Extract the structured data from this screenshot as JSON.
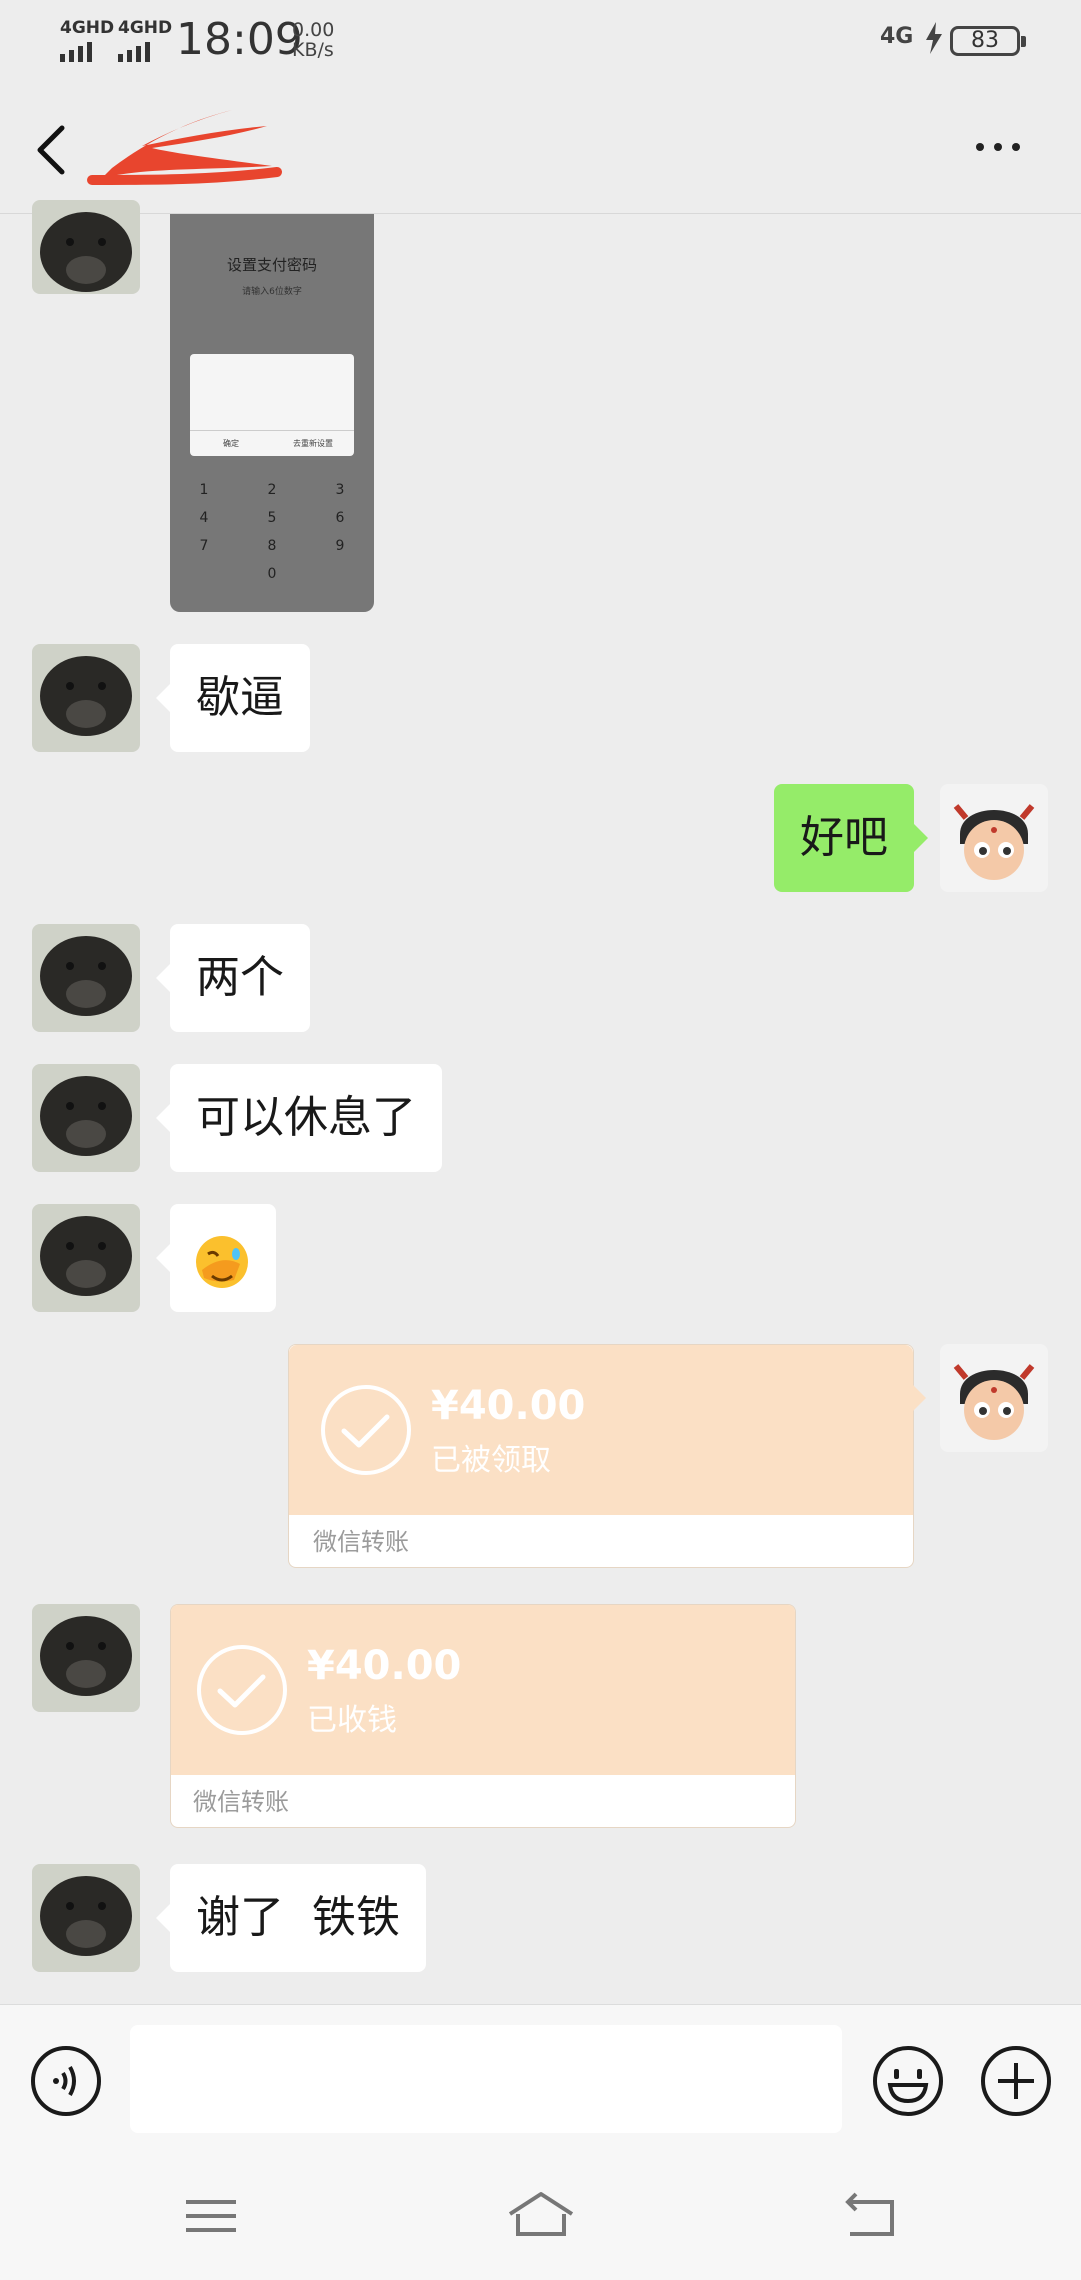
{
  "status_bar": {
    "signal1_label": "4GHD",
    "signal2_label": "4GHD",
    "time": "18:09",
    "speed_value": "0.00",
    "speed_unit": "KB/s",
    "network_label": "4G",
    "battery_percent": "83"
  },
  "nav": {
    "back_icon": "chevron-left-icon",
    "more_icon": "more-dots-icon"
  },
  "screenshot_image": {
    "title": "设置支付密码",
    "subtitle": "请输入6位数字",
    "dialog_confirm": "确定",
    "dialog_other": "去重新设置",
    "keys": [
      "1",
      "2",
      "3",
      "4",
      "5",
      "6",
      "7",
      "8",
      "9",
      "",
      "0",
      ""
    ]
  },
  "messages": [
    {
      "side": "in",
      "type": "image"
    },
    {
      "side": "in",
      "type": "text",
      "text": "歇逼"
    },
    {
      "side": "out",
      "type": "text",
      "text": "好吧"
    },
    {
      "side": "in",
      "type": "text",
      "text": "两个"
    },
    {
      "side": "in",
      "type": "text",
      "text": "可以休息了"
    },
    {
      "side": "in",
      "type": "emoji",
      "emoji": "🤦"
    },
    {
      "side": "out",
      "type": "transfer",
      "amount": "¥40.00",
      "status": "已被领取",
      "footer": "微信转账"
    },
    {
      "side": "in",
      "type": "transfer",
      "amount": "¥40.00",
      "status": "已收钱",
      "footer": "微信转账"
    },
    {
      "side": "in",
      "type": "text",
      "text": "谢了  铁铁"
    }
  ],
  "input_bar": {
    "voice_icon": "voice-icon",
    "emoji_icon": "emoji-icon",
    "plus_icon": "plus-icon",
    "placeholder": ""
  },
  "colors": {
    "background": "#ededed",
    "out_bubble": "#95ec69",
    "in_bubble": "#ffffff",
    "transfer": "#fbe0c5"
  }
}
